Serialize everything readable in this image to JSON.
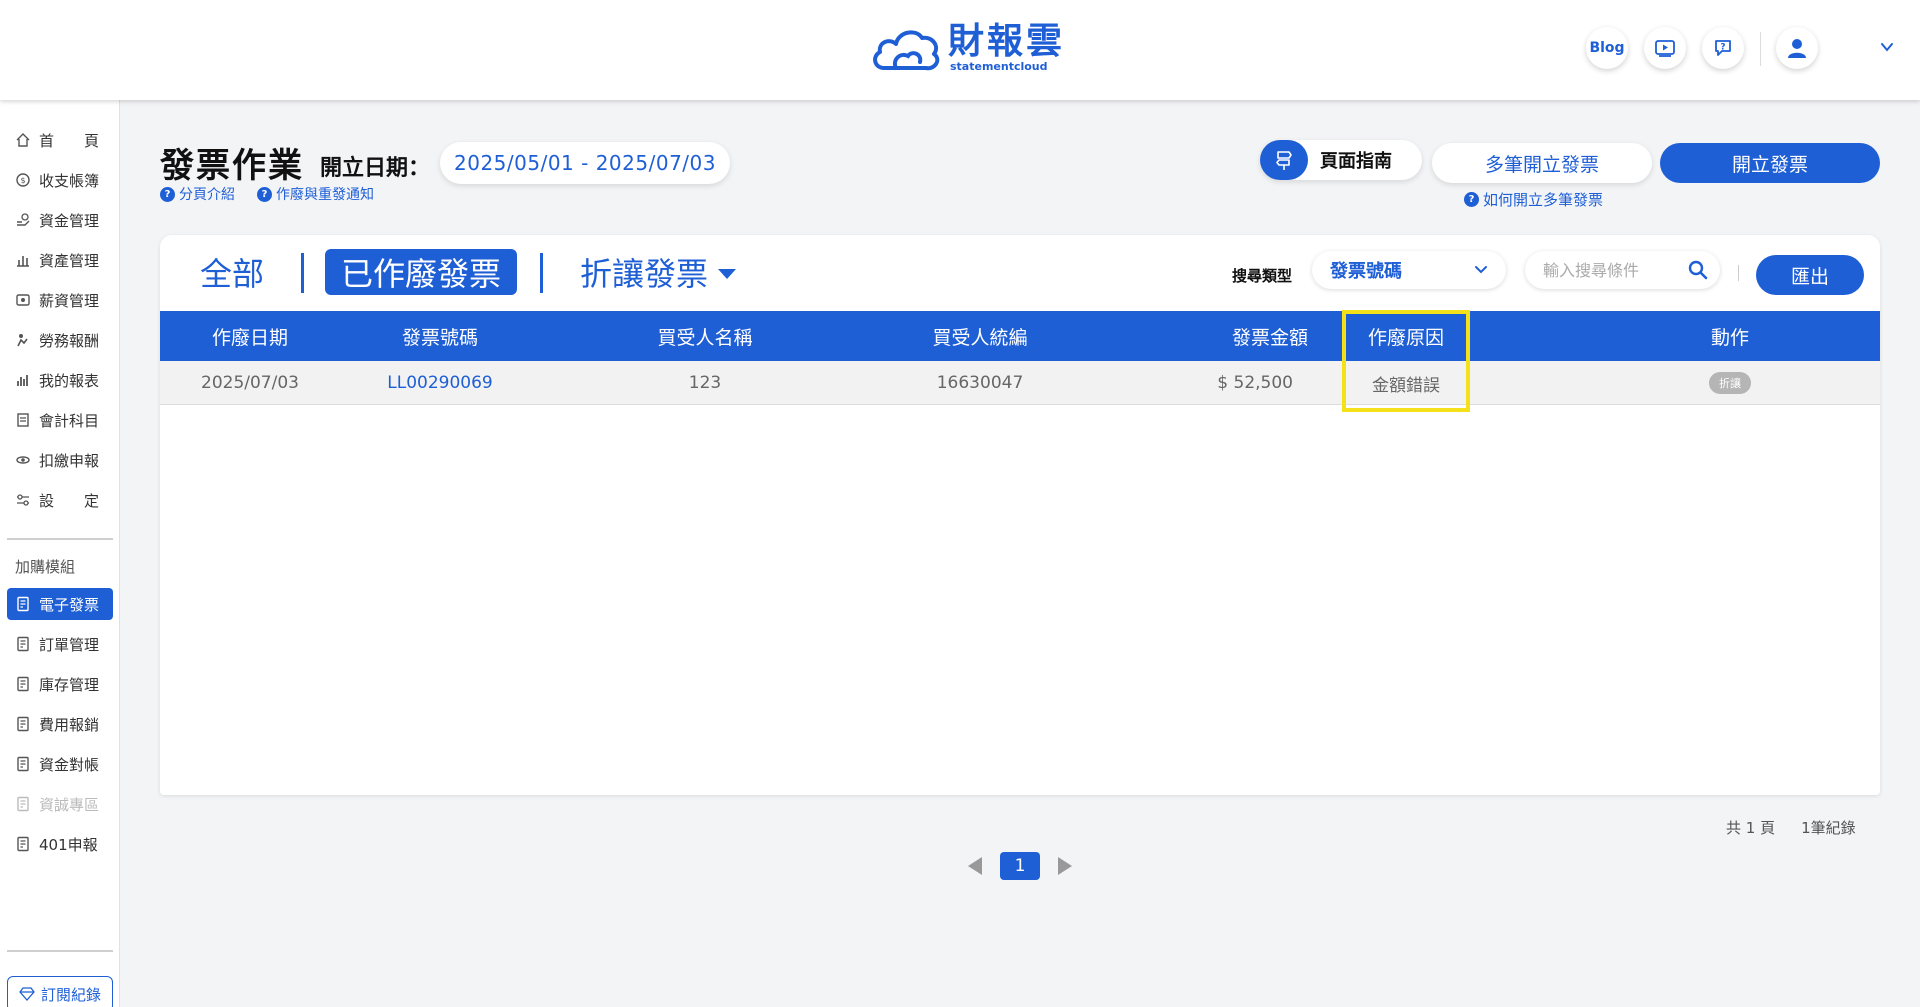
{
  "header": {
    "brand": "財報雲",
    "brand_sub": "statementcloud",
    "blog_label": "Blog"
  },
  "sidebar": {
    "items": [
      {
        "label": "首　　頁",
        "icon": "home-icon"
      },
      {
        "label": "收支帳簿",
        "icon": "coin-icon"
      },
      {
        "label": "資金管理",
        "icon": "hand-money-icon"
      },
      {
        "label": "資產管理",
        "icon": "assets-icon"
      },
      {
        "label": "薪資管理",
        "icon": "salary-icon"
      },
      {
        "label": "勞務報酬",
        "icon": "service-icon"
      },
      {
        "label": "我的報表",
        "icon": "chart-icon"
      },
      {
        "label": "會計科目",
        "icon": "ledger-icon"
      },
      {
        "label": "扣繳申報",
        "icon": "tax-icon"
      },
      {
        "label": "設　　定",
        "icon": "settings-icon"
      }
    ],
    "section_label": "加購模組",
    "modules": [
      {
        "label": "電子發票",
        "active": true,
        "disabled": false
      },
      {
        "label": "訂單管理",
        "active": false,
        "disabled": false
      },
      {
        "label": "庫存管理",
        "active": false,
        "disabled": false
      },
      {
        "label": "費用報銷",
        "active": false,
        "disabled": false
      },
      {
        "label": "資金對帳",
        "active": false,
        "disabled": false
      },
      {
        "label": "資誠專區",
        "active": false,
        "disabled": true
      },
      {
        "label": "401申報",
        "active": false,
        "disabled": false
      }
    ],
    "subscription_label": "訂閱紀錄"
  },
  "page": {
    "title": "發票作業",
    "date_label": "開立日期：",
    "date_range": "2025/05/01 - 2025/07/03",
    "help_intro": "分頁介紹",
    "help_void": "作廢與重發通知",
    "guide_label": "頁面指南",
    "multi_issue_label": "多筆開立發票",
    "issue_label": "開立發票",
    "multi_help": "如何開立多筆發票"
  },
  "tabs": {
    "all": "全部",
    "voided": "已作廢發票",
    "discount": "折讓發票"
  },
  "search": {
    "type_label": "搜尋類型",
    "type_value": "發票號碼",
    "placeholder": "輸入搜尋條件",
    "export_label": "匯出"
  },
  "table": {
    "headers": [
      "作廢日期",
      "發票號碼",
      "買受人名稱",
      "買受人統編",
      "發票金額",
      "作廢原因",
      "動作"
    ],
    "rows": [
      {
        "void_date": "2025/07/03",
        "invoice_no": "LL00290069",
        "buyer_name": "123",
        "buyer_tax_id": "16630047",
        "amount": "$ 52,500",
        "void_reason": "金額錯誤",
        "action": "折讓"
      }
    ]
  },
  "pagination": {
    "total_pages": "共 1 頁",
    "total_records": "1筆紀錄",
    "current_page": "1"
  },
  "colors": {
    "primary": "#1f5fd6",
    "highlight": "#f5e11a"
  }
}
